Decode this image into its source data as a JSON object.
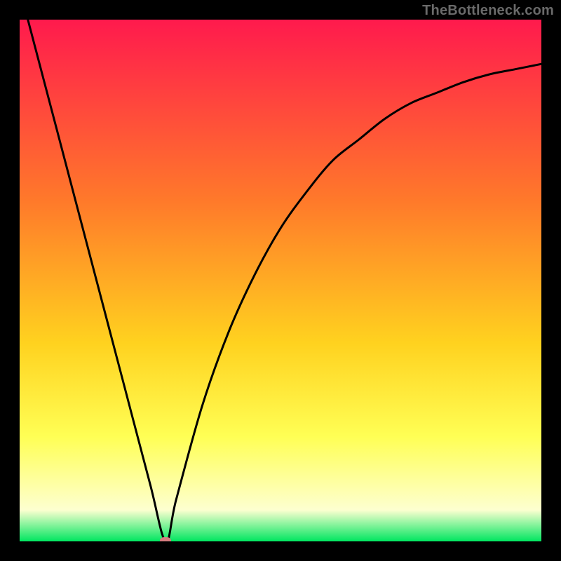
{
  "watermark": "TheBottleneck.com",
  "colors": {
    "bg_black": "#000000",
    "grad_top": "#ff1a4d",
    "grad_mid1": "#ff7a2a",
    "grad_mid2": "#ffd21f",
    "grad_mid3": "#ffff55",
    "grad_mid4": "#fdffd0",
    "grad_bottom": "#00e660",
    "curve": "#000000",
    "marker": "#d67d80",
    "watermark": "#6a6a6a"
  },
  "chart_data": {
    "type": "line",
    "title": "",
    "xlabel": "",
    "ylabel": "",
    "xlim": [
      0,
      100
    ],
    "ylim": [
      0,
      100
    ],
    "series": [
      {
        "name": "bottleneck-curve",
        "x": [
          0,
          5,
          10,
          15,
          20,
          25,
          28,
          30,
          35,
          40,
          45,
          50,
          55,
          60,
          65,
          70,
          75,
          80,
          85,
          90,
          95,
          100
        ],
        "values": [
          106,
          87,
          68,
          49,
          30,
          11,
          0,
          8,
          26,
          40,
          51,
          60,
          67,
          73,
          77,
          81,
          84,
          86,
          88,
          89.5,
          90.5,
          91.5
        ]
      }
    ],
    "marker": {
      "x": 28,
      "y": 0
    },
    "annotations": []
  }
}
